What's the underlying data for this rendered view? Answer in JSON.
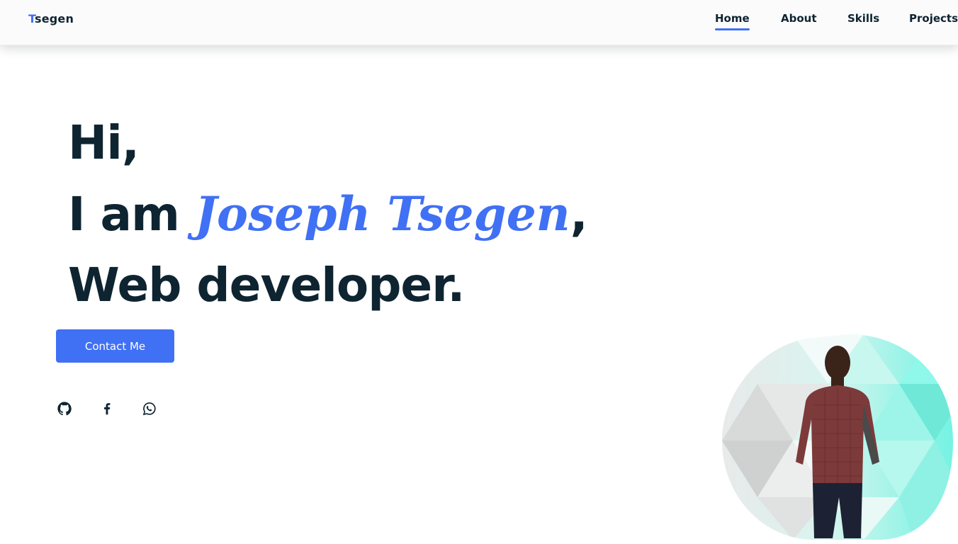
{
  "header": {
    "logo_first": "T",
    "logo_rest": "segen",
    "nav": [
      {
        "label": "Home",
        "active": true
      },
      {
        "label": "About",
        "active": false
      },
      {
        "label": "Skills",
        "active": false
      },
      {
        "label": "Projects",
        "active": false
      }
    ]
  },
  "hero": {
    "line1": "Hi,",
    "line2_prefix": "I am ",
    "name": "Joseph Tsegen",
    "line2_suffix": ",",
    "line3": "Web developer.",
    "cta_label": "Contact Me"
  },
  "socials": [
    {
      "icon": "github-icon"
    },
    {
      "icon": "facebook-icon"
    },
    {
      "icon": "whatsapp-icon"
    }
  ],
  "colors": {
    "accent": "#4070f4",
    "text": "#0e2431",
    "teal": "#7ef7e8"
  }
}
